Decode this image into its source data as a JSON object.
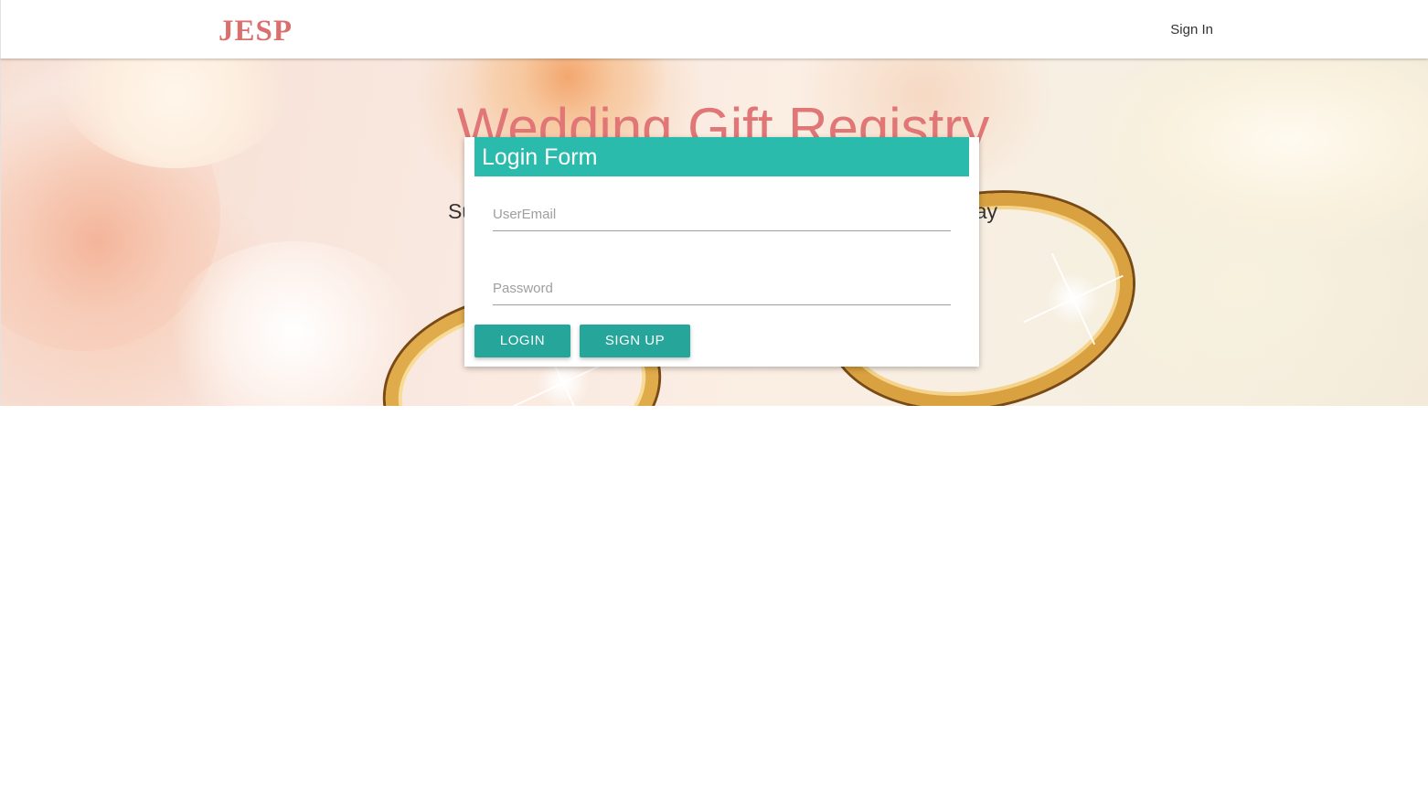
{
  "navbar": {
    "brand": "JESP",
    "sign_in": "Sign In"
  },
  "hero": {
    "title": "Wedding Gift Registry",
    "subtitle_left": "Su",
    "subtitle_right": "ay"
  },
  "login_form": {
    "title": "Login Form",
    "email_placeholder": "UserEmail",
    "password_placeholder": "Password",
    "login_button": "LOGIN",
    "signup_button": "SIGN UP"
  },
  "colors": {
    "brand": "#d9706d",
    "hero_title": "#e07676",
    "form_header": "#2bbbad",
    "button": "#26a69a"
  }
}
